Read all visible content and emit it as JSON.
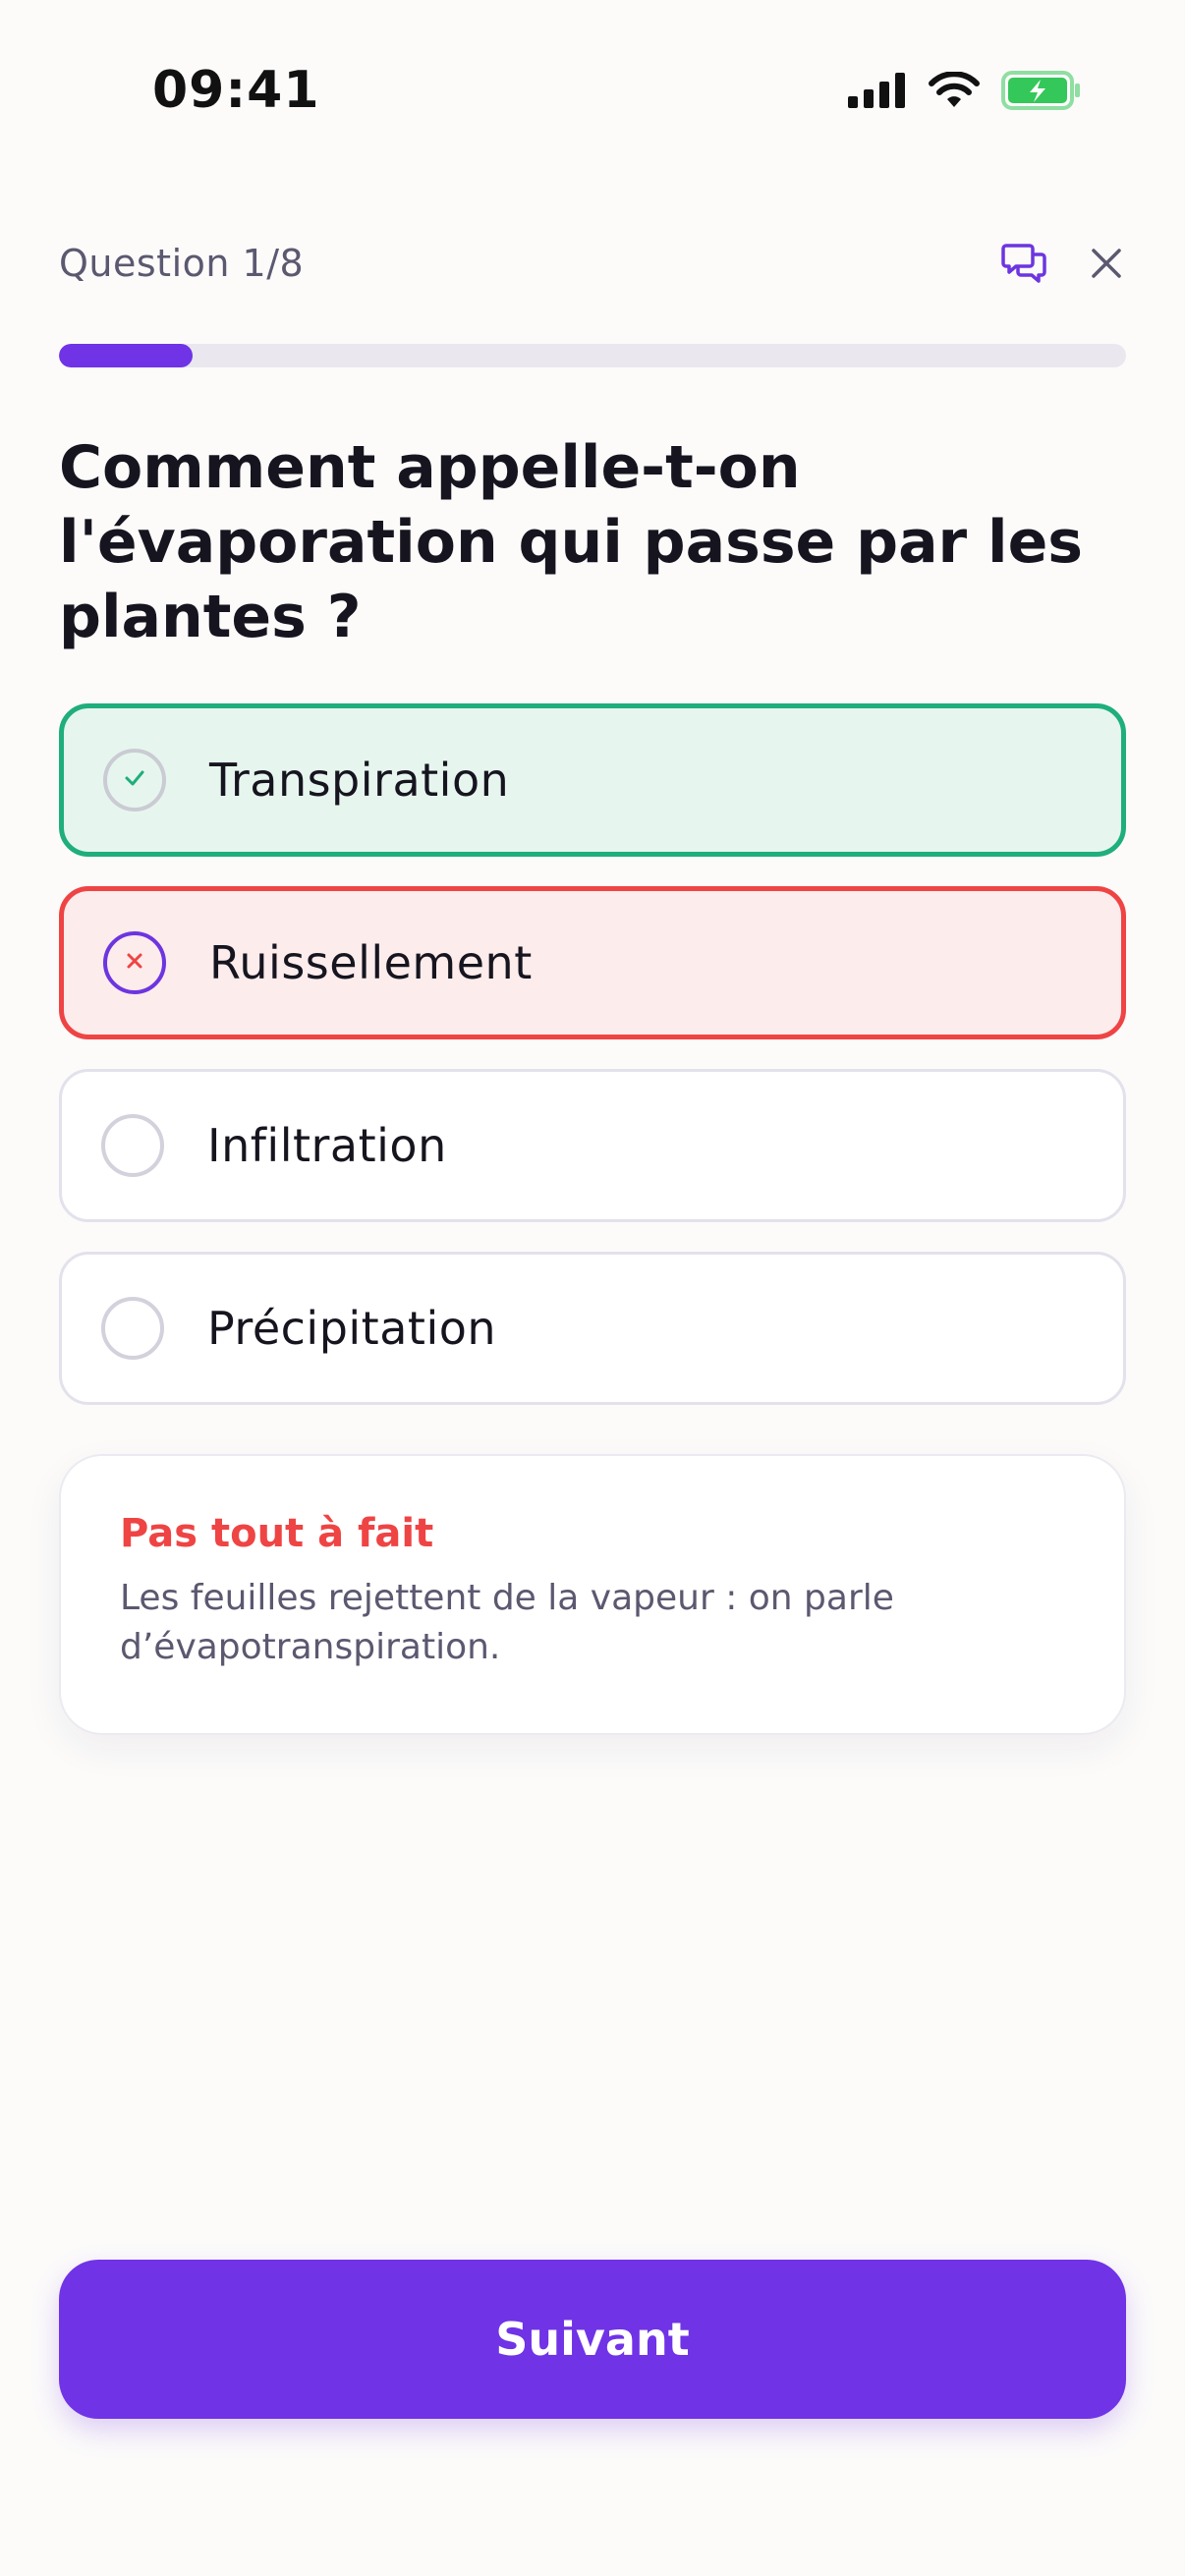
{
  "status_bar": {
    "time": "09:41",
    "icons": [
      "cellular-signal-icon",
      "wifi-icon",
      "battery-charging-icon"
    ]
  },
  "header": {
    "question_counter": "Question 1/8",
    "feedback_icon": "chat-bubbles-icon",
    "close_icon": "close-icon"
  },
  "progress": {
    "current": 1,
    "total": 8,
    "fraction": 0.125
  },
  "question": {
    "text": "Comment appelle-t-on l'évaporation qui passe par les plantes ?"
  },
  "options": [
    {
      "label": "Transpiration",
      "state": "correct"
    },
    {
      "label": "Ruissellement",
      "state": "wrong"
    },
    {
      "label": "Infiltration",
      "state": "neutral"
    },
    {
      "label": "Précipitation",
      "state": "neutral"
    }
  ],
  "feedback": {
    "title": "Pas tout à fait",
    "text": "Les feuilles rejettent de la vapeur : on parle d’évapotranspiration."
  },
  "next_button": {
    "label": "Suivant"
  },
  "colors": {
    "accent": "#7033E6",
    "correct": "#1FAE7C",
    "correct_bg": "#E6F6EE",
    "wrong": "#EF4444",
    "wrong_bg": "#FDECEC",
    "progress_track": "#EAE7EF"
  }
}
